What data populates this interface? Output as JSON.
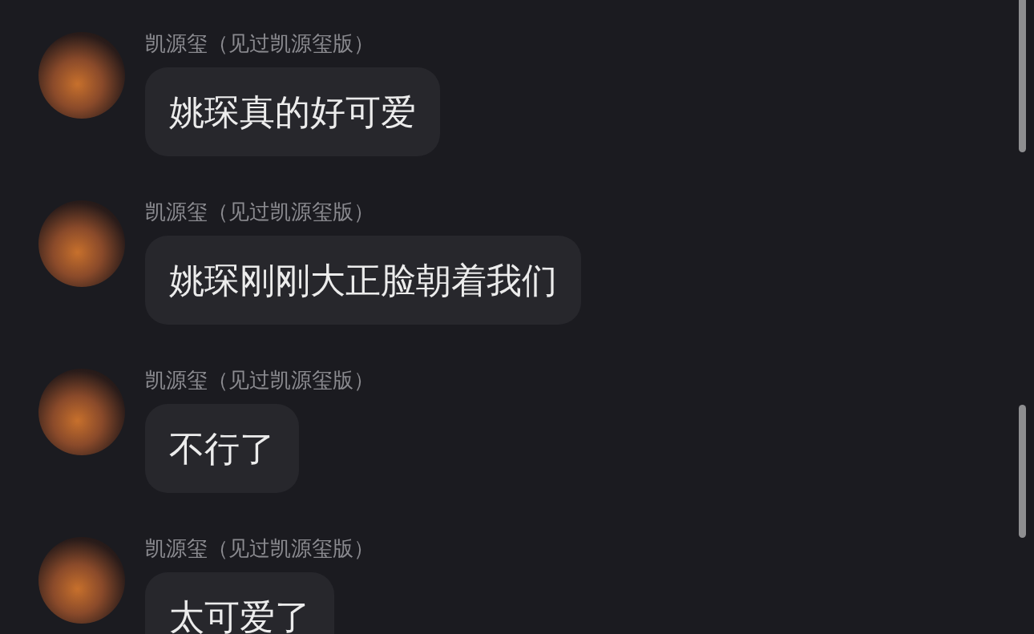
{
  "messages": [
    {
      "sender": "凯源玺（见过凯源玺版）",
      "text": "姚琛真的好可爱"
    },
    {
      "sender": "凯源玺（见过凯源玺版）",
      "text": "姚琛刚刚大正脸朝着我们"
    },
    {
      "sender": "凯源玺（见过凯源玺版）",
      "text": "不行了"
    },
    {
      "sender": "凯源玺（见过凯源玺版）",
      "text": "太可爱了"
    }
  ]
}
